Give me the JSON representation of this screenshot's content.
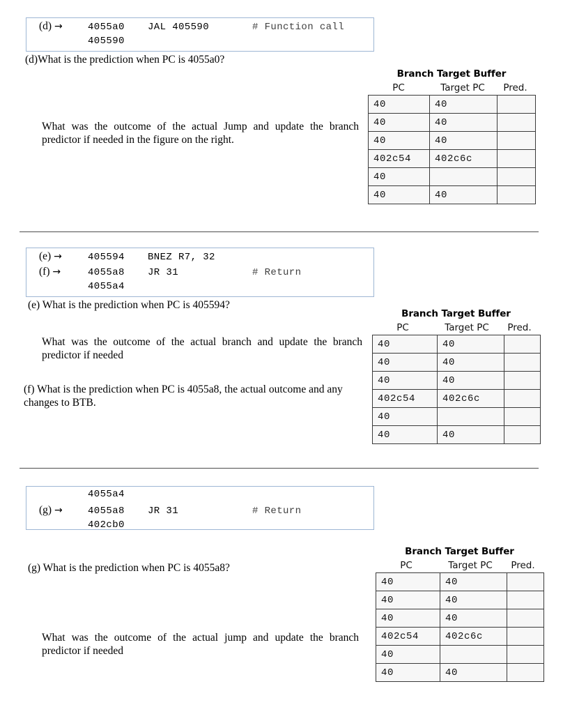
{
  "document": {
    "title": "Branch prediction exercise (parts d-g)"
  },
  "sections": [
    {
      "id": "d",
      "code_box": {
        "lines": [
          {
            "tag": "(d)",
            "arrow": "→",
            "addr": "4055a0",
            "instr": "JAL  405590",
            "comment": "# Function call"
          },
          {
            "tag": "",
            "arrow": "",
            "addr": "405590",
            "instr": "",
            "comment": ""
          }
        ]
      },
      "prompt": "(d)What is the prediction when PC is 4055a0?",
      "followup": "What was the outcome of the actual Jump and update the branch predictor if needed in the figure on the right.",
      "table": {
        "title": "Branch Target Buffer",
        "headers": [
          "PC",
          "Target PC",
          "Pred."
        ],
        "rows": [
          [
            "40",
            "40",
            ""
          ],
          [
            "40",
            "40",
            ""
          ],
          [
            "40",
            "40",
            ""
          ],
          [
            "402c54",
            "402c6c",
            ""
          ],
          [
            "40",
            "",
            ""
          ],
          [
            "40",
            "40",
            ""
          ]
        ]
      }
    },
    {
      "id": "ef",
      "code_box": {
        "lines": [
          {
            "tag": "(e)",
            "arrow": "→",
            "addr": "405594",
            "instr": "BNEZ R7, 32",
            "comment": ""
          },
          {
            "tag": "(f)",
            "arrow": "→",
            "addr": "4055a8",
            "instr": "JR 31",
            "comment": "# Return"
          },
          {
            "tag": "",
            "arrow": "",
            "addr": "4055a4",
            "instr": "",
            "comment": ""
          }
        ]
      },
      "prompt": "(e)  What is the prediction when PC is 405594?",
      "followup": "What was the outcome of the actual branch and update the branch predictor if needed",
      "prompt2": "(f) What is the prediction when PC is 4055a8, the actual outcome and any changes to BTB.",
      "table": {
        "title": "Branch Target Buffer",
        "headers": [
          "PC",
          "Target PC",
          "Pred."
        ],
        "rows": [
          [
            "40",
            "40",
            ""
          ],
          [
            "40",
            "40",
            ""
          ],
          [
            "40",
            "40",
            ""
          ],
          [
            "402c54",
            "402c6c",
            ""
          ],
          [
            "40",
            "",
            ""
          ],
          [
            "40",
            "40",
            ""
          ]
        ]
      }
    },
    {
      "id": "g",
      "code_box": {
        "lines": [
          {
            "tag": "",
            "arrow": "",
            "addr": "4055a4",
            "instr": "",
            "comment": ""
          },
          {
            "tag": "(g)",
            "arrow": "→",
            "addr": "4055a8",
            "instr": "JR 31",
            "comment": "# Return"
          },
          {
            "tag": "",
            "arrow": "",
            "addr": "402cb0",
            "instr": "",
            "comment": ""
          }
        ]
      },
      "prompt": "(g)  What is the prediction when PC is 4055a8?",
      "followup": "What was the outcome of the actual jump and update the branch predictor if needed",
      "table": {
        "title": "Branch Target Buffer",
        "headers": [
          "PC",
          "Target PC",
          "Pred."
        ],
        "rows": [
          [
            "40",
            "40",
            ""
          ],
          [
            "40",
            "40",
            ""
          ],
          [
            "40",
            "40",
            ""
          ],
          [
            "402c54",
            "402c6c",
            ""
          ],
          [
            "40",
            "",
            ""
          ],
          [
            "40",
            "40",
            ""
          ]
        ]
      }
    }
  ],
  "colors": {
    "code_box_border": "#9eb6d4",
    "table_border": "#3a3a3a",
    "table_cell_bg": "#f7f7f7",
    "separator": "#4d4d4d"
  }
}
